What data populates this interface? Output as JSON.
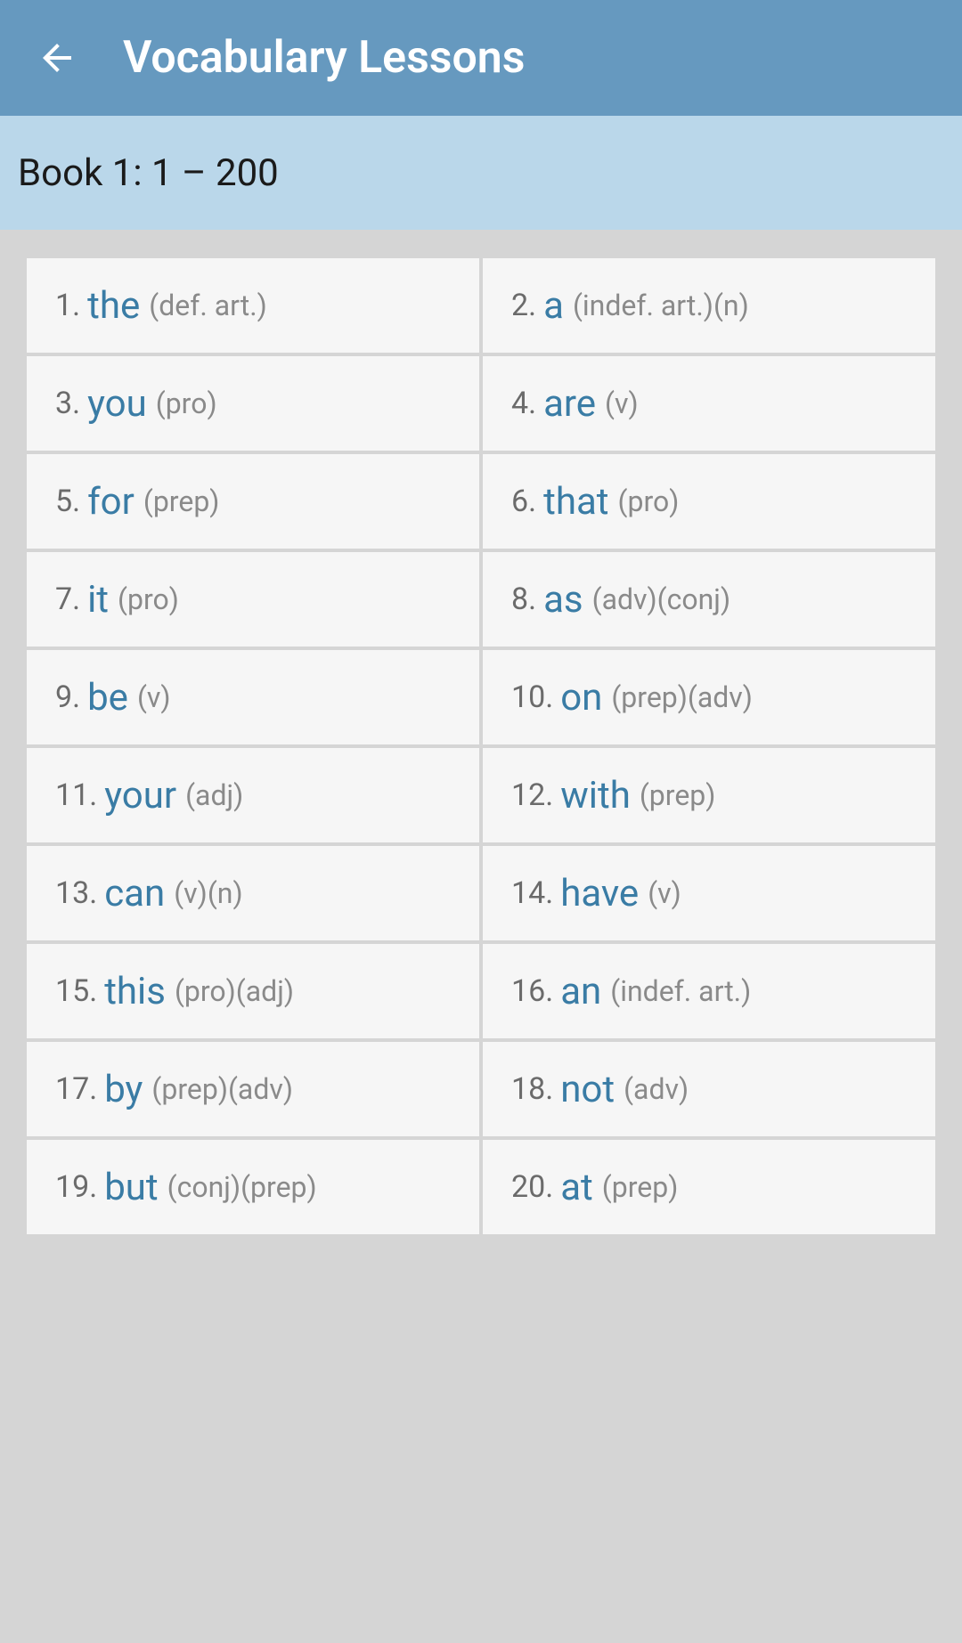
{
  "header": {
    "title": "Vocabulary Lessons"
  },
  "subheader": {
    "text": "Book 1:    1 – 200"
  },
  "items": [
    {
      "num": "1.",
      "word": "the",
      "pos": "(def. art.)"
    },
    {
      "num": "2.",
      "word": "a",
      "pos": "(indef. art.)(n)"
    },
    {
      "num": "3.",
      "word": "you",
      "pos": "(pro)"
    },
    {
      "num": "4.",
      "word": "are",
      "pos": "(v)"
    },
    {
      "num": "5.",
      "word": "for",
      "pos": "(prep)"
    },
    {
      "num": "6.",
      "word": "that",
      "pos": "(pro)"
    },
    {
      "num": "7.",
      "word": "it",
      "pos": "(pro)"
    },
    {
      "num": "8.",
      "word": "as",
      "pos": "(adv)(conj)"
    },
    {
      "num": "9.",
      "word": "be",
      "pos": "(v)"
    },
    {
      "num": "10.",
      "word": "on",
      "pos": "(prep)(adv)"
    },
    {
      "num": "11.",
      "word": "your",
      "pos": "(adj)"
    },
    {
      "num": "12.",
      "word": "with",
      "pos": "(prep)"
    },
    {
      "num": "13.",
      "word": "can",
      "pos": "(v)(n)"
    },
    {
      "num": "14.",
      "word": "have",
      "pos": "(v)"
    },
    {
      "num": "15.",
      "word": "this",
      "pos": "(pro)(adj)"
    },
    {
      "num": "16.",
      "word": "an",
      "pos": "(indef. art.)"
    },
    {
      "num": "17.",
      "word": "by",
      "pos": "(prep)(adv)"
    },
    {
      "num": "18.",
      "word": "not",
      "pos": "(adv)"
    },
    {
      "num": "19.",
      "word": "but",
      "pos": "(conj)(prep)"
    },
    {
      "num": "20.",
      "word": "at",
      "pos": "(prep)"
    }
  ]
}
